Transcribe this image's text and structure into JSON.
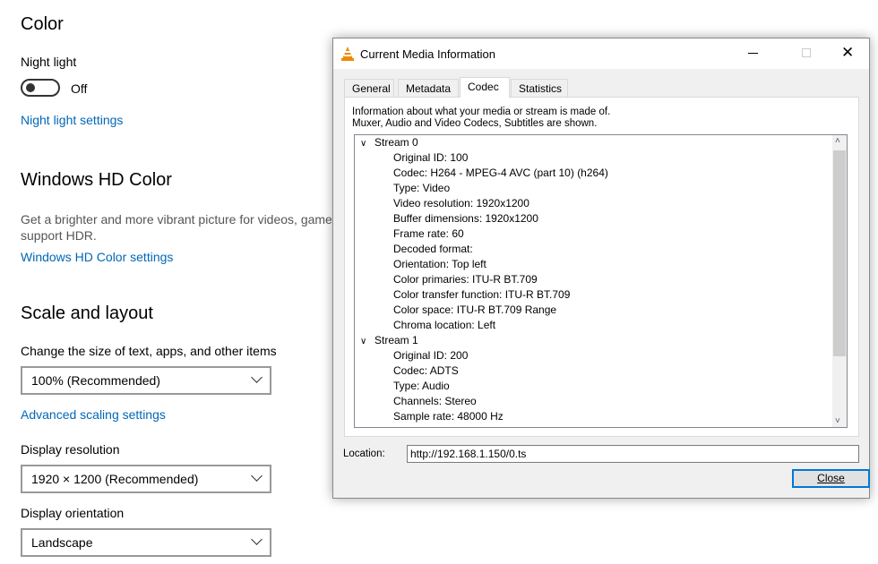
{
  "settings": {
    "color_heading": "Color",
    "night_light_label": "Night light",
    "night_light_state": "Off",
    "night_light_on": false,
    "night_light_link": "Night light settings",
    "hd_heading": "Windows HD Color",
    "hd_desc_1": "Get a brighter and more vibrant picture for videos, games",
    "hd_desc_2": "support HDR.",
    "hd_link": "Windows HD Color settings",
    "scale_heading": "Scale and layout",
    "scale_label": "Change the size of text, apps, and other items",
    "scale_value": "100% (Recommended)",
    "advanced_link": "Advanced scaling settings",
    "resolution_label": "Display resolution",
    "resolution_value": "1920 × 1200 (Recommended)",
    "orientation_label": "Display orientation",
    "orientation_value": "Landscape"
  },
  "dialog": {
    "title": "Current Media Information",
    "tabs": [
      {
        "label": "General"
      },
      {
        "label": "Metadata"
      },
      {
        "label": "Codec",
        "active": true
      },
      {
        "label": "Statistics"
      }
    ],
    "info_1": "Information about what your media or stream is made of.",
    "info_2": "Muxer, Audio and Video Codecs, Subtitles are shown.",
    "streams": [
      {
        "name": "Stream 0",
        "items": [
          "Original ID: 100",
          "Codec: H264 - MPEG-4 AVC (part 10) (h264)",
          "Type: Video",
          "Video resolution: 1920x1200",
          "Buffer dimensions: 1920x1200",
          "Frame rate: 60",
          "Decoded format:",
          "Orientation: Top left",
          "Color primaries: ITU-R BT.709",
          "Color transfer function: ITU-R BT.709",
          "Color space: ITU-R BT.709 Range",
          "Chroma location: Left"
        ]
      },
      {
        "name": "Stream 1",
        "items": [
          "Original ID: 200",
          "Codec: ADTS",
          "Type: Audio",
          "Channels: Stereo",
          "Sample rate: 48000 Hz"
        ]
      }
    ],
    "location_label": "Location:",
    "location_value": "http://192.168.1.150/0.ts",
    "close_label": "Close"
  }
}
